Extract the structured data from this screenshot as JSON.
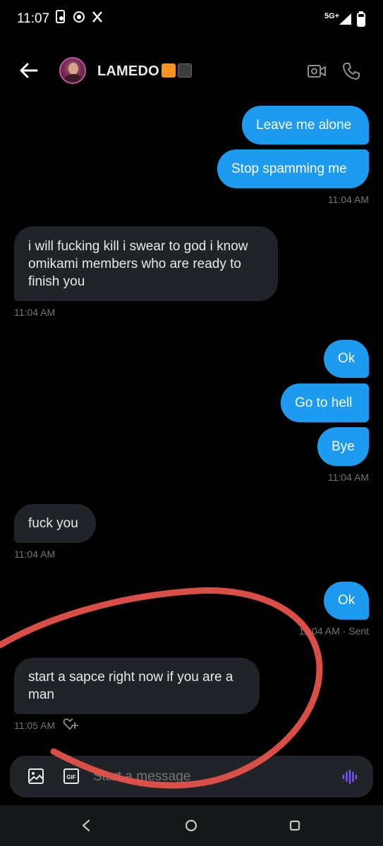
{
  "status_bar": {
    "time": "11:07",
    "network": "5G+"
  },
  "header": {
    "contact_name": "LAMEDO",
    "name_emoji": [
      "orange-square",
      "black-square"
    ]
  },
  "messages": [
    {
      "side": "out",
      "text": "Leave me alone"
    },
    {
      "side": "out",
      "text": "Stop spamming me"
    },
    {
      "meta": "11:04 AM"
    },
    {
      "side": "in",
      "text": "i will fucking kill i swear to god i know omikami members who are ready to finish you"
    },
    {
      "meta": "11:04 AM"
    },
    {
      "side": "out",
      "text": "Ok"
    },
    {
      "side": "out",
      "text": "Go to hell"
    },
    {
      "side": "out",
      "text": "Bye"
    },
    {
      "meta": "11:04 AM"
    },
    {
      "side": "in",
      "text": "fuck you"
    },
    {
      "meta": "11:04 AM"
    },
    {
      "side": "out",
      "text": "Ok"
    },
    {
      "meta": "11:04 AM · Sent"
    },
    {
      "side": "in",
      "text": "start a sapce right now if you are a man"
    },
    {
      "meta": "11:05 AM"
    }
  ],
  "composer": {
    "placeholder": "Start a message"
  },
  "colors": {
    "outgoing_bubble": "#1d9bf0",
    "incoming_bubble": "#202327",
    "annotation_stroke": "#e5534b",
    "voice_icon": "#7856ff"
  },
  "icons": [
    "back-arrow-icon",
    "video-call-icon",
    "phone-call-icon",
    "image-icon",
    "gif-icon",
    "voice-message-icon",
    "react-heart-icon",
    "nav-back-icon",
    "nav-home-icon",
    "nav-recents-icon"
  ]
}
